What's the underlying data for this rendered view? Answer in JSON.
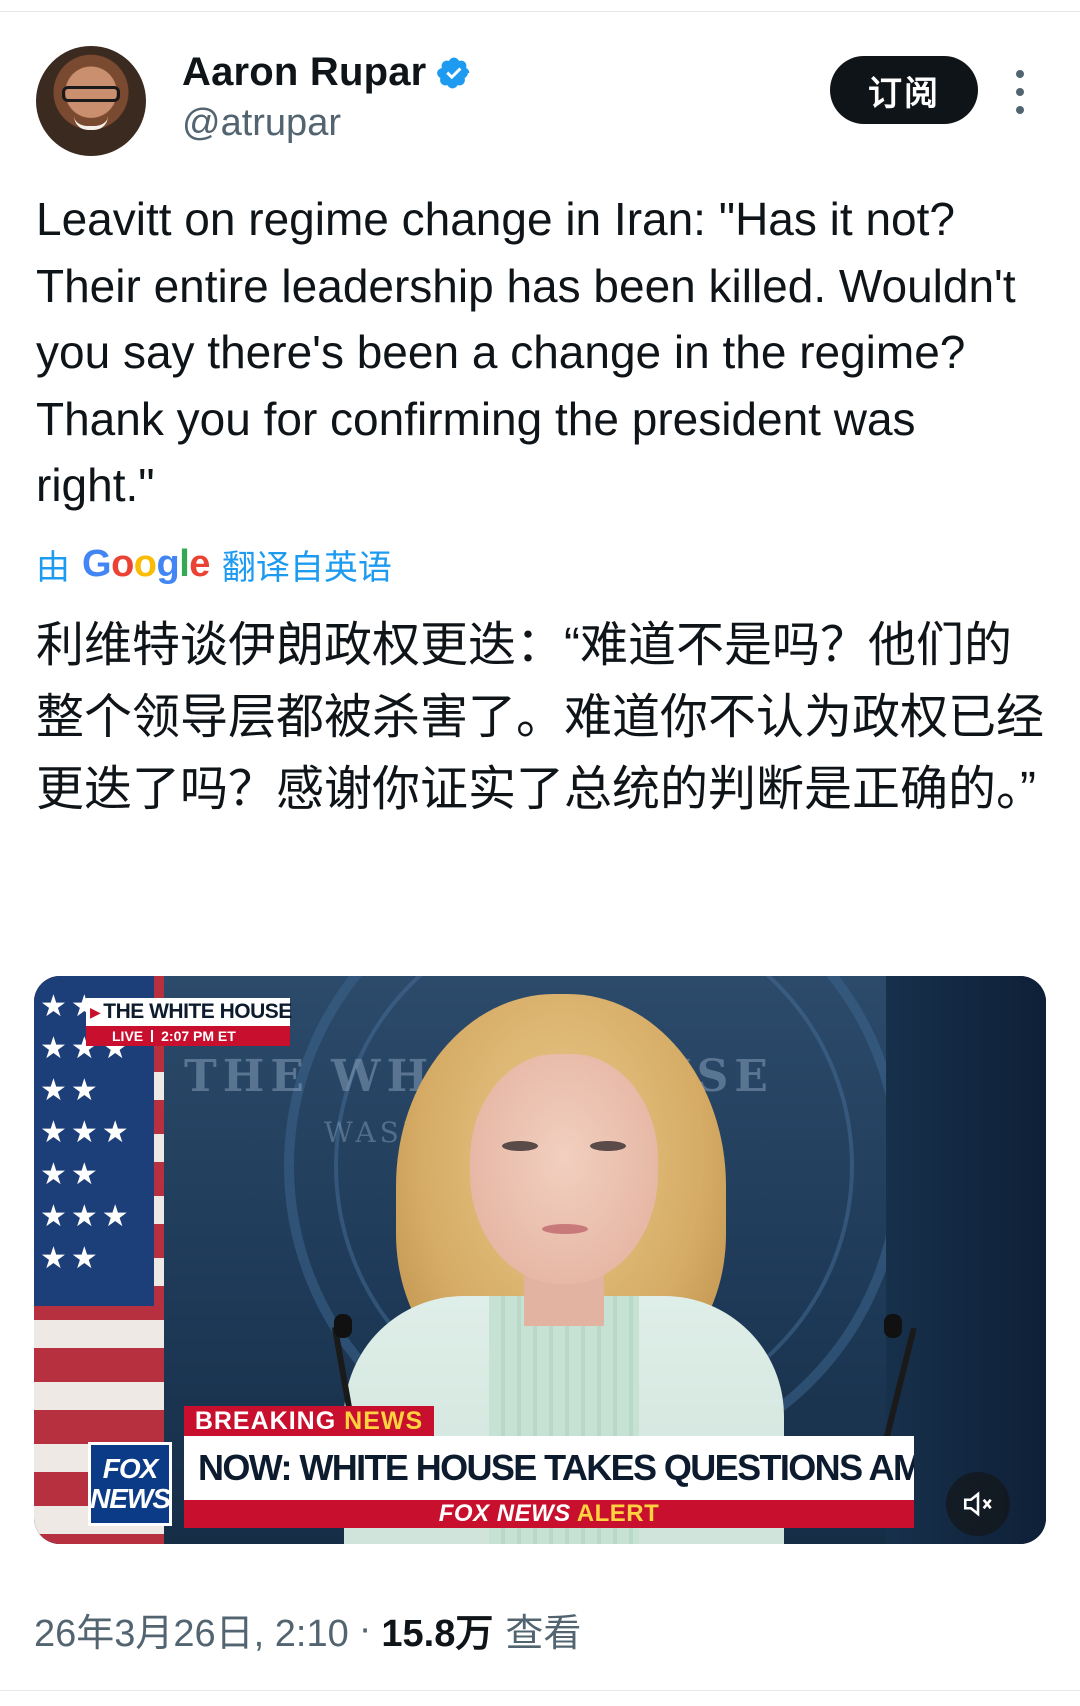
{
  "author": {
    "display_name": "Aaron Rupar",
    "handle": "@atrupar",
    "verified": true
  },
  "actions": {
    "subscribe_label": "订阅"
  },
  "tweet": {
    "text": "Leavitt on regime change in Iran: \"Has it not? Their entire leadership has been killed. Wouldn't you say there's been a change in the regime? Thank you for confirming the president was right.\"",
    "translate_prefix": "由",
    "translate_provider": "Google",
    "translate_suffix": "翻译自英语",
    "translated_text": "利维特谈伊朗政权更迭：“难道不是吗？他们的整个领导层都被杀害了。难道你不认为政权已经更迭了吗？感谢你证实了总统的判断是正确的。”"
  },
  "media": {
    "wall_text": "THE WHITE HOUSE",
    "wall_subtext": "WASH",
    "flag_stars": "★★ ★★★ ★★ ★★★ ★★ ★★★ ★★",
    "bug_title": "THE WHITE HOUSE",
    "bug_live": "LIVE",
    "bug_time": "2:07 PM ET",
    "breaking": "BREAKING",
    "breaking_news": "NEWS",
    "logo_line1": "FOX",
    "logo_line2": "NEWS",
    "headline": "NOW: WHITE HOUSE TAKES QUESTIONS AMID WAR IN IRAN",
    "alert_brand": "FOX NEWS",
    "alert_word": "ALERT",
    "mute_icon": "speaker-muted-icon"
  },
  "meta": {
    "date_time": "26年3月26日, 2:10",
    "separator": "·",
    "views": "15.8万",
    "views_label": "查看"
  },
  "colors": {
    "accent": "#1d9bf0",
    "button_bg": "#0f1419",
    "secondary_text": "#536471",
    "fox_red": "#c8102e",
    "fox_blue": "#0b3b86"
  }
}
